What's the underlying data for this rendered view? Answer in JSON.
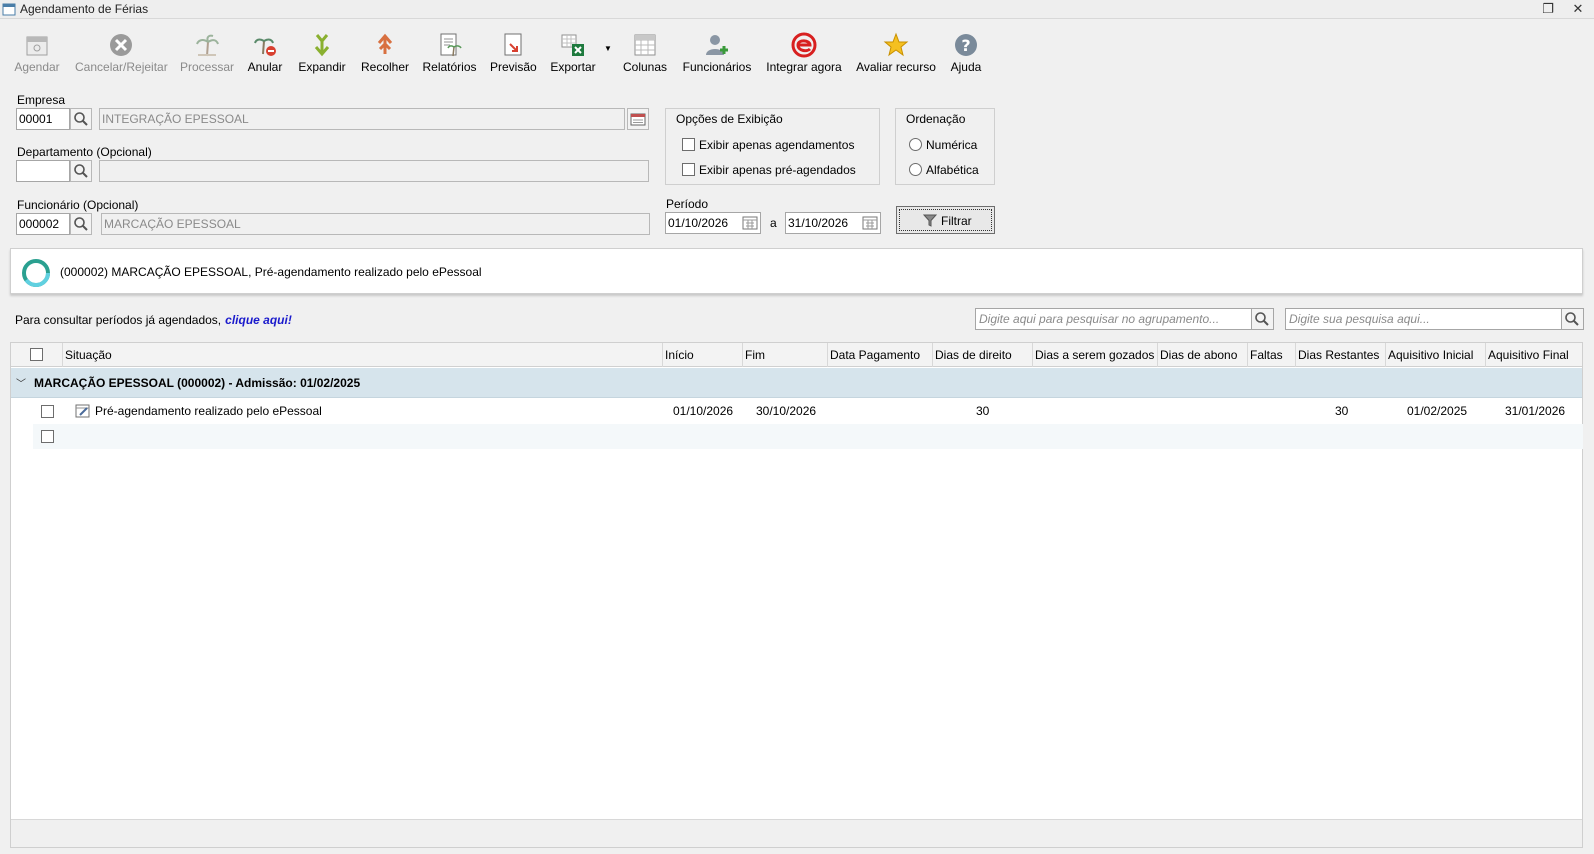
{
  "window": {
    "title": "Agendamento de Férias"
  },
  "toolbar": {
    "agendar": "Agendar",
    "cancelar": "Cancelar/Rejeitar",
    "processar": "Processar",
    "anular": "Anular",
    "expandir": "Expandir",
    "recolher": "Recolher",
    "relatorios": "Relatórios",
    "previsao": "Previsão",
    "exportar": "Exportar",
    "colunas": "Colunas",
    "funcionarios": "Funcionários",
    "integrar": "Integrar agora",
    "avaliar": "Avaliar recurso",
    "ajuda": "Ajuda"
  },
  "form": {
    "empresa_label": "Empresa",
    "empresa_code": "00001",
    "empresa_name": "INTEGRAÇÃO EPESSOAL",
    "departamento_label": "Departamento (Opcional)",
    "departamento_code": "",
    "departamento_name": "",
    "funcionario_label": "Funcionário (Opcional)",
    "funcionario_code": "000002",
    "funcionario_name": "MARCAÇÃO EPESSOAL",
    "periodo_label": "Período",
    "periodo_inicio": "01/10/2026",
    "periodo_sep": "a",
    "periodo_fim": "31/10/2026"
  },
  "opcoes": {
    "title": "Opções de Exibição",
    "opt1": "Exibir apenas agendamentos",
    "opt2": "Exibir apenas pré-agendados"
  },
  "ordenacao": {
    "title": "Ordenação",
    "opt1": "Numérica",
    "opt2": "Alfabética"
  },
  "filter_label": "Filtrar",
  "info": {
    "message": "(000002) MARCAÇÃO EPESSOAL, Pré-agendamento realizado pelo ePessoal"
  },
  "consult": {
    "text": "Para consultar períodos já agendados,",
    "link": "clique aqui!"
  },
  "search": {
    "group_placeholder": "Digite aqui para pesquisar no agrupamento...",
    "main_placeholder": "Digite sua pesquisa aqui..."
  },
  "grid": {
    "columns": [
      "Situação",
      "Início",
      "Fim",
      "Data Pagamento",
      "Dias de direito",
      "Dias a serem gozados",
      "Dias de abono",
      "Faltas",
      "Dias Restantes",
      "Aquisitivo Inicial",
      "Aquisitivo Final"
    ],
    "group": "MARCAÇÃO EPESSOAL (000002)  - Admissão: 01/02/2025",
    "rows": [
      {
        "situacao": "Pré-agendamento realizado pelo ePessoal",
        "inicio": "01/10/2026",
        "fim": "30/10/2026",
        "data_pagamento": "",
        "dias_direito": "30",
        "dias_gozados": "",
        "dias_abono": "",
        "faltas": "",
        "dias_restantes": "30",
        "aquisitivo_inicial": "01/02/2025",
        "aquisitivo_final": "31/01/2026"
      }
    ]
  }
}
